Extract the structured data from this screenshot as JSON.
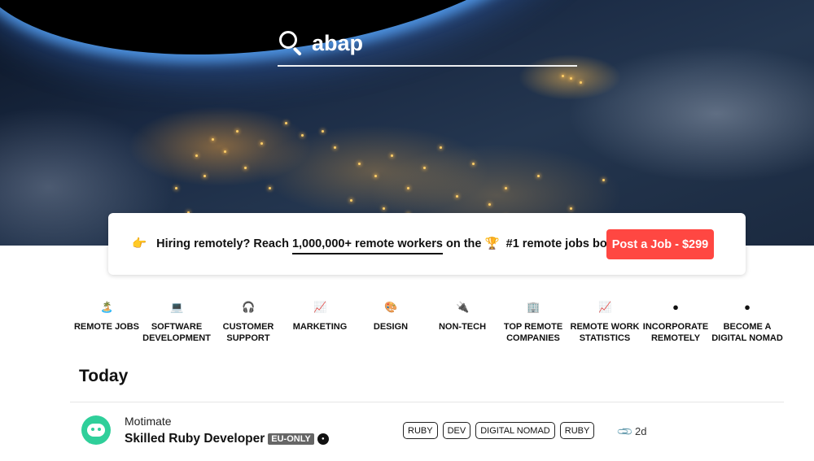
{
  "search": {
    "query": "abap"
  },
  "banner": {
    "emoji_left": "👉",
    "text_prefix": "Hiring remotely? Reach",
    "text_link": "1,000,000+ remote workers",
    "text_mid": "on the",
    "emoji_trophy": "🏆",
    "text_suffix": "#1 remote jobs board",
    "post_button": "Post a Job - $299"
  },
  "categories": [
    {
      "icon": "🏝️",
      "icon_name": "island-icon",
      "label": "REMOTE JOBS"
    },
    {
      "icon": "💻",
      "icon_name": "laptop-icon",
      "label": "SOFTWARE DEVELOPMENT"
    },
    {
      "icon": "🎧",
      "icon_name": "headphones-icon",
      "label": "CUSTOMER SUPPORT"
    },
    {
      "icon": "📈",
      "icon_name": "chart-up-icon",
      "label": "MARKETING"
    },
    {
      "icon": "🎨",
      "icon_name": "palette-icon",
      "label": "DESIGN"
    },
    {
      "icon": "🔌",
      "icon_name": "plug-icon",
      "label": "NON-TECH"
    },
    {
      "icon": "🏢",
      "icon_name": "office-building-icon",
      "label": "TOP REMOTE COMPANIES"
    },
    {
      "icon": "📈",
      "icon_name": "chart-up-icon",
      "label": "REMOTE WORK STATISTICS"
    },
    {
      "icon": "●",
      "icon_name": "incorporate-logo-icon",
      "label": "INCORPORATE REMOTELY"
    },
    {
      "icon": "●",
      "icon_name": "nomad-logo-icon",
      "label": "BECOME A DIGITAL NOMAD"
    }
  ],
  "section_title": "Today",
  "job": {
    "company": "Motimate",
    "title": "Skilled Ruby Developer",
    "badge": "EU-ONLY",
    "tags": [
      "RUBY",
      "DEV",
      "DIGITAL NOMAD",
      "RUBY"
    ],
    "age": "2d"
  },
  "colors": {
    "post_button": "#ff4742",
    "logo": "#2fcf9a",
    "badge": "#666666"
  }
}
